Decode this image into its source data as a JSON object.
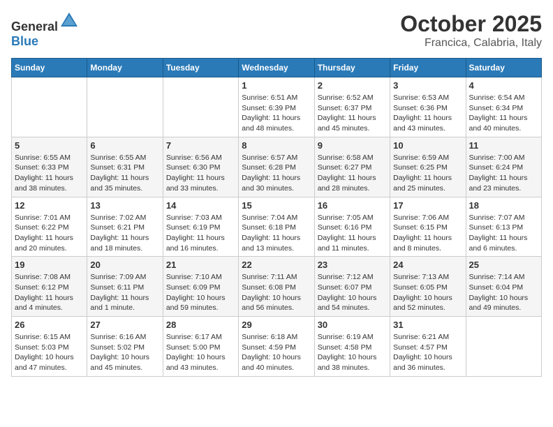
{
  "header": {
    "logo_general": "General",
    "logo_blue": "Blue",
    "month": "October 2025",
    "location": "Francica, Calabria, Italy"
  },
  "days_of_week": [
    "Sunday",
    "Monday",
    "Tuesday",
    "Wednesday",
    "Thursday",
    "Friday",
    "Saturday"
  ],
  "weeks": [
    [
      {
        "day": "",
        "info": ""
      },
      {
        "day": "",
        "info": ""
      },
      {
        "day": "",
        "info": ""
      },
      {
        "day": "1",
        "info": "Sunrise: 6:51 AM\nSunset: 6:39 PM\nDaylight: 11 hours and 48 minutes."
      },
      {
        "day": "2",
        "info": "Sunrise: 6:52 AM\nSunset: 6:37 PM\nDaylight: 11 hours and 45 minutes."
      },
      {
        "day": "3",
        "info": "Sunrise: 6:53 AM\nSunset: 6:36 PM\nDaylight: 11 hours and 43 minutes."
      },
      {
        "day": "4",
        "info": "Sunrise: 6:54 AM\nSunset: 6:34 PM\nDaylight: 11 hours and 40 minutes."
      }
    ],
    [
      {
        "day": "5",
        "info": "Sunrise: 6:55 AM\nSunset: 6:33 PM\nDaylight: 11 hours and 38 minutes."
      },
      {
        "day": "6",
        "info": "Sunrise: 6:55 AM\nSunset: 6:31 PM\nDaylight: 11 hours and 35 minutes."
      },
      {
        "day": "7",
        "info": "Sunrise: 6:56 AM\nSunset: 6:30 PM\nDaylight: 11 hours and 33 minutes."
      },
      {
        "day": "8",
        "info": "Sunrise: 6:57 AM\nSunset: 6:28 PM\nDaylight: 11 hours and 30 minutes."
      },
      {
        "day": "9",
        "info": "Sunrise: 6:58 AM\nSunset: 6:27 PM\nDaylight: 11 hours and 28 minutes."
      },
      {
        "day": "10",
        "info": "Sunrise: 6:59 AM\nSunset: 6:25 PM\nDaylight: 11 hours and 25 minutes."
      },
      {
        "day": "11",
        "info": "Sunrise: 7:00 AM\nSunset: 6:24 PM\nDaylight: 11 hours and 23 minutes."
      }
    ],
    [
      {
        "day": "12",
        "info": "Sunrise: 7:01 AM\nSunset: 6:22 PM\nDaylight: 11 hours and 20 minutes."
      },
      {
        "day": "13",
        "info": "Sunrise: 7:02 AM\nSunset: 6:21 PM\nDaylight: 11 hours and 18 minutes."
      },
      {
        "day": "14",
        "info": "Sunrise: 7:03 AM\nSunset: 6:19 PM\nDaylight: 11 hours and 16 minutes."
      },
      {
        "day": "15",
        "info": "Sunrise: 7:04 AM\nSunset: 6:18 PM\nDaylight: 11 hours and 13 minutes."
      },
      {
        "day": "16",
        "info": "Sunrise: 7:05 AM\nSunset: 6:16 PM\nDaylight: 11 hours and 11 minutes."
      },
      {
        "day": "17",
        "info": "Sunrise: 7:06 AM\nSunset: 6:15 PM\nDaylight: 11 hours and 8 minutes."
      },
      {
        "day": "18",
        "info": "Sunrise: 7:07 AM\nSunset: 6:13 PM\nDaylight: 11 hours and 6 minutes."
      }
    ],
    [
      {
        "day": "19",
        "info": "Sunrise: 7:08 AM\nSunset: 6:12 PM\nDaylight: 11 hours and 4 minutes."
      },
      {
        "day": "20",
        "info": "Sunrise: 7:09 AM\nSunset: 6:11 PM\nDaylight: 11 hours and 1 minute."
      },
      {
        "day": "21",
        "info": "Sunrise: 7:10 AM\nSunset: 6:09 PM\nDaylight: 10 hours and 59 minutes."
      },
      {
        "day": "22",
        "info": "Sunrise: 7:11 AM\nSunset: 6:08 PM\nDaylight: 10 hours and 56 minutes."
      },
      {
        "day": "23",
        "info": "Sunrise: 7:12 AM\nSunset: 6:07 PM\nDaylight: 10 hours and 54 minutes."
      },
      {
        "day": "24",
        "info": "Sunrise: 7:13 AM\nSunset: 6:05 PM\nDaylight: 10 hours and 52 minutes."
      },
      {
        "day": "25",
        "info": "Sunrise: 7:14 AM\nSunset: 6:04 PM\nDaylight: 10 hours and 49 minutes."
      }
    ],
    [
      {
        "day": "26",
        "info": "Sunrise: 6:15 AM\nSunset: 5:03 PM\nDaylight: 10 hours and 47 minutes."
      },
      {
        "day": "27",
        "info": "Sunrise: 6:16 AM\nSunset: 5:02 PM\nDaylight: 10 hours and 45 minutes."
      },
      {
        "day": "28",
        "info": "Sunrise: 6:17 AM\nSunset: 5:00 PM\nDaylight: 10 hours and 43 minutes."
      },
      {
        "day": "29",
        "info": "Sunrise: 6:18 AM\nSunset: 4:59 PM\nDaylight: 10 hours and 40 minutes."
      },
      {
        "day": "30",
        "info": "Sunrise: 6:19 AM\nSunset: 4:58 PM\nDaylight: 10 hours and 38 minutes."
      },
      {
        "day": "31",
        "info": "Sunrise: 6:21 AM\nSunset: 4:57 PM\nDaylight: 10 hours and 36 minutes."
      },
      {
        "day": "",
        "info": ""
      }
    ]
  ]
}
